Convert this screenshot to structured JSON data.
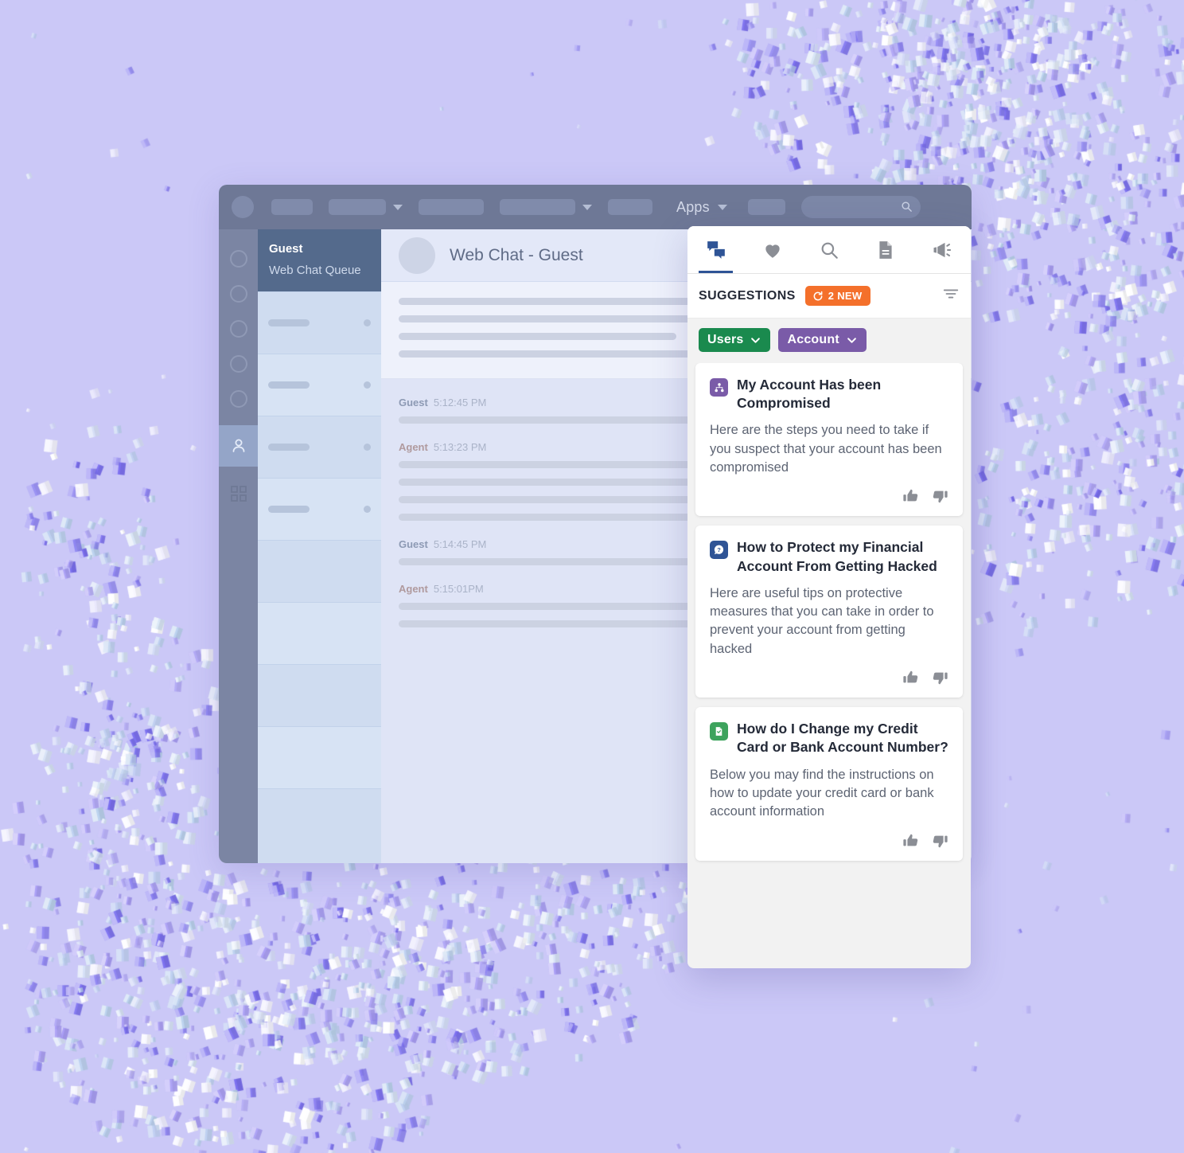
{
  "background": {
    "color": "#cbc8f7",
    "confetti_color_palette": [
      "#7b6ff0",
      "#a99df5",
      "#d9e6f6",
      "#ffffff",
      "#bcd3ef"
    ]
  },
  "window": {
    "header": {
      "apps_label": "Apps",
      "search_placeholder": "",
      "search_icon": "search-icon",
      "dot_icon": "window-logo-dot"
    },
    "icon_rail": {
      "items": [
        "circle-icon",
        "circle-icon",
        "circle-icon",
        "circle-icon",
        "circle-icon"
      ],
      "active_item": "person-icon",
      "bottom_item": "grid-icon"
    },
    "queue": {
      "selected": {
        "name": "Guest",
        "subtitle": "Web Chat Queue"
      },
      "rows": [
        {
          "placeholder": true
        },
        {
          "placeholder": true
        },
        {
          "placeholder": true
        }
      ]
    },
    "chat": {
      "avatar": "contact-avatar",
      "title": "Web Chat - Guest",
      "messages": [
        {
          "who": "Guest",
          "time": "5:12:45 PM",
          "lines": [
            1
          ]
        },
        {
          "who": "Agent",
          "time": "5:13:23 PM",
          "lines": [
            1,
            0.78,
            0.6,
            0.78
          ]
        },
        {
          "who": "Guest",
          "time": "5:14:45 PM",
          "lines": [
            1
          ]
        },
        {
          "who": "Agent",
          "time": "5:15:01PM",
          "lines": [
            1,
            0.78
          ]
        }
      ]
    }
  },
  "panel": {
    "tabs": [
      {
        "name": "chat-tab",
        "icon": "chat-bubbles-icon",
        "active": true
      },
      {
        "name": "favorites-tab",
        "icon": "heart-icon",
        "active": false
      },
      {
        "name": "search-tab",
        "icon": "search-icon",
        "active": false
      },
      {
        "name": "documents-tab",
        "icon": "document-icon",
        "active": false
      },
      {
        "name": "announcements-tab",
        "icon": "megaphone-icon",
        "active": false
      }
    ],
    "title": "SUGGESTIONS",
    "new_badge": {
      "label": "2 NEW",
      "icon": "refresh-icon",
      "color": "#f4702b"
    },
    "filter_icon": "filter-icon",
    "chips": [
      {
        "label": "Users",
        "color": "#1a8a4e",
        "icon": "chevron-down-icon"
      },
      {
        "label": "Account",
        "color": "#7a5ba8",
        "icon": "chevron-down-icon"
      }
    ],
    "cards": [
      {
        "icon": "sitemap-icon",
        "icon_color": "#7a5ba8",
        "title": "My Account Has been Compromised",
        "body": "Here are the steps  you need to take if you suspect that your account has been compromised",
        "thumbs_up_icon": "thumbs-up-icon",
        "thumbs_down_icon": "thumbs-down-icon"
      },
      {
        "icon": "question-bubble-icon",
        "icon_color": "#2f5496",
        "title": "How to Protect my Financial Account From Getting Hacked",
        "body": "Here are useful tips on protective measures that you can take in order to prevent your account from getting hacked",
        "thumbs_up_icon": "thumbs-up-icon",
        "thumbs_down_icon": "thumbs-down-icon"
      },
      {
        "icon": "document-icon",
        "icon_color": "#3da35d",
        "title": "How do I Change my Credit Card or Bank Account Number?",
        "body": "Below you may find the instructions on how to update your credit card or bank account information",
        "thumbs_up_icon": "thumbs-up-icon",
        "thumbs_down_icon": "thumbs-down-icon"
      }
    ]
  }
}
